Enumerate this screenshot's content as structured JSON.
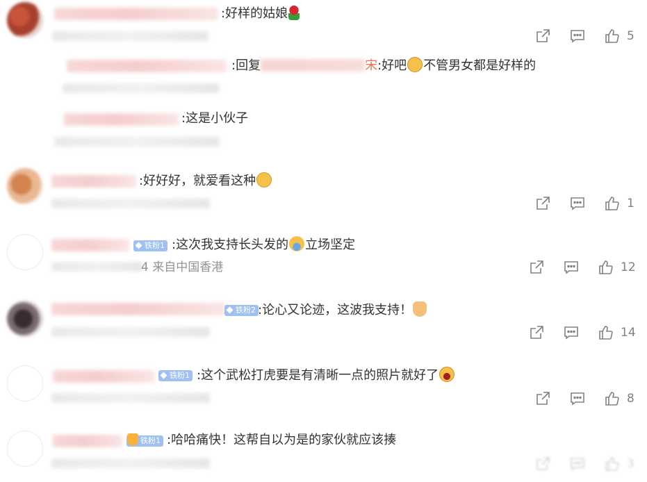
{
  "comments": [
    {
      "text": ":好样的姑娘",
      "emoji": "rose-emoji",
      "likes": "5",
      "replies": [
        {
          "text_before": ":回复",
          "reply_to_fragment": "宋",
          "text_after": ":好吧",
          "emoji": "cat-emoji",
          "text_tail": "不管男女都是好样的"
        },
        {
          "text": ":这是小伙子"
        }
      ]
    },
    {
      "text": ":好好好，就爱看这种",
      "emoji": "thinking-emoji",
      "likes": "1"
    },
    {
      "badge": "铁粉1",
      "text": ":这次我支持长头发的",
      "emoji": "crying-emoji",
      "text_tail": "立场坚定",
      "meta_visible": "4 来自中国香港",
      "likes": "12"
    },
    {
      "badge": "铁粉2",
      "text": ":论心又论迹，这波我支持！",
      "emoji": "thumbs-up-emoji",
      "likes": "14"
    },
    {
      "badge": "铁粉1",
      "text": ":这个武松打虎要是有清晰一点的照片就好了",
      "emoji": "laughing-emoji",
      "likes": "8"
    },
    {
      "badge": "铁粉1",
      "text": ":哈哈痛快！这帮自以为是的家伙就应该揍",
      "likes": "3"
    }
  ],
  "icons": {
    "share": "share-icon",
    "comment": "comment-icon",
    "like": "thumbs-up-icon"
  },
  "colors": {
    "badge": "#9fc1f1",
    "text": "#333333",
    "meta": "#939393",
    "icon": "#808080",
    "reply_to": "#eb7350"
  }
}
